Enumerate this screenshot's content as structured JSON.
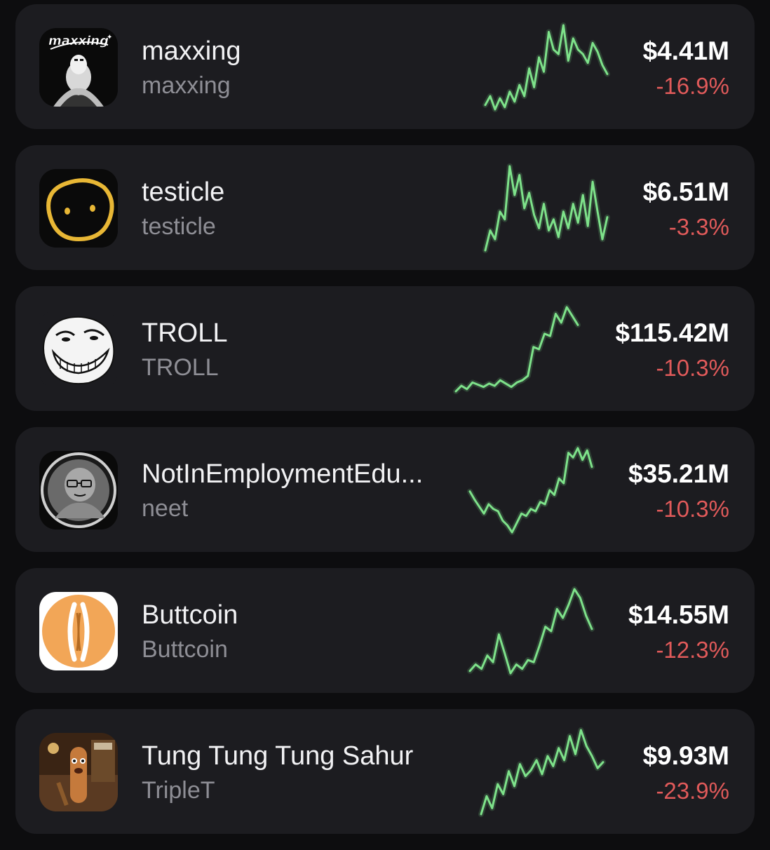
{
  "colors": {
    "background": "#0d0d0f",
    "card": "#1c1c20",
    "sparkline": "#7ee28a",
    "negative": "#e05a5a",
    "secondary_text": "#8e8e95"
  },
  "tokens": [
    {
      "name": "maxxing",
      "ticker": "maxxing",
      "market_cap": "$4.41M",
      "change": "-16.9%",
      "icon": "maxxing-logo-icon",
      "logo_text": "maxxing",
      "sparkline": [
        22,
        30,
        18,
        28,
        20,
        34,
        25,
        40,
        30,
        55,
        38,
        65,
        52,
        88,
        72,
        68,
        94,
        62,
        82,
        72,
        68,
        60,
        78,
        70,
        58,
        50
      ]
    },
    {
      "name": "testicle",
      "ticker": "testicle",
      "market_cap": "$6.51M",
      "change": "-3.3%",
      "icon": "potato-face-icon",
      "sparkline": [
        20,
        38,
        30,
        55,
        48,
        96,
        70,
        88,
        58,
        72,
        52,
        40,
        62,
        38,
        48,
        32,
        55,
        40,
        62,
        45,
        70,
        42,
        82,
        55,
        30,
        50
      ]
    },
    {
      "name": "TROLL",
      "ticker": "TROLL",
      "market_cap": "$115.42M",
      "change": "-10.3%",
      "icon": "troll-face-icon",
      "sparkline": [
        20,
        25,
        22,
        28,
        26,
        24,
        27,
        25,
        30,
        27,
        24,
        28,
        30,
        34,
        60,
        58,
        72,
        70,
        90,
        82,
        96,
        88,
        80
      ]
    },
    {
      "name": "NotInEmploymentEdu...",
      "ticker": "neet",
      "market_cap": "$35.21M",
      "change": "-10.3%",
      "icon": "bald-man-avatar-icon",
      "sparkline": [
        55,
        48,
        42,
        36,
        44,
        40,
        38,
        30,
        26,
        20,
        28,
        36,
        34,
        40,
        38,
        46,
        44,
        56,
        52,
        66,
        62,
        88,
        84,
        92,
        82,
        90,
        76
      ]
    },
    {
      "name": "Buttcoin",
      "ticker": "Buttcoin",
      "market_cap": "$14.55M",
      "change": "-12.3%",
      "icon": "buttcoin-logo-icon",
      "sparkline": [
        22,
        28,
        24,
        36,
        30,
        55,
        38,
        20,
        28,
        24,
        32,
        30,
        45,
        62,
        58,
        78,
        70,
        82,
        96,
        88,
        72,
        60
      ]
    },
    {
      "name": "Tung Tung Tung Sahur",
      "ticker": "TripleT",
      "market_cap": "$9.93M",
      "change": "-23.9%",
      "icon": "tung-tung-character-icon",
      "sparkline": [
        12,
        30,
        18,
        42,
        32,
        55,
        40,
        62,
        50,
        56,
        66,
        52,
        70,
        60,
        78,
        66,
        90,
        72,
        96,
        80,
        70,
        58,
        64
      ]
    }
  ]
}
